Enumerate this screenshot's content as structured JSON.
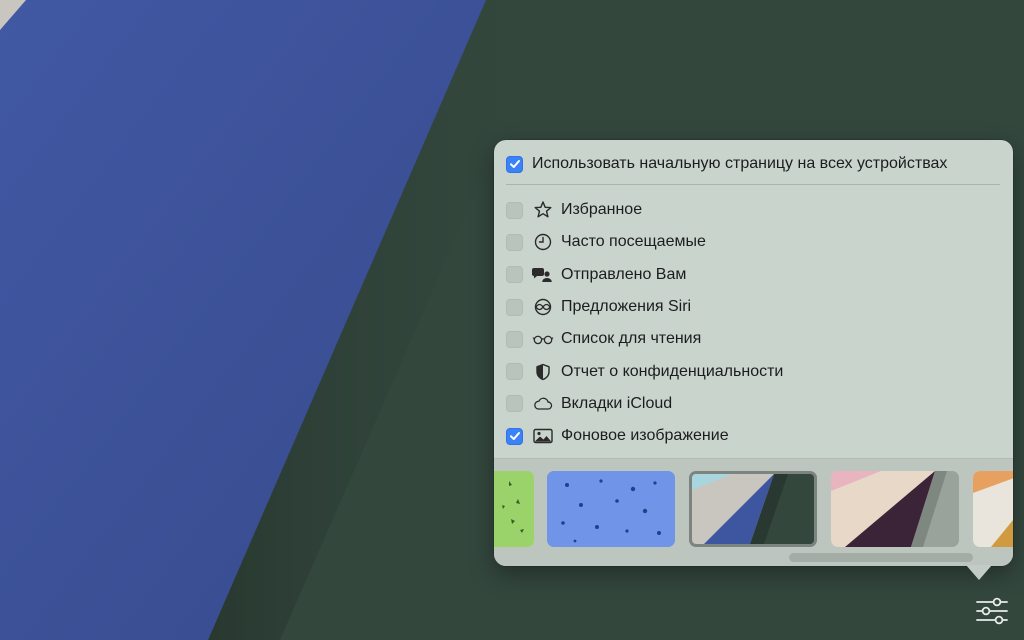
{
  "master": {
    "label": "Использовать начальную страницу на всех устройствах",
    "checked": true
  },
  "items": [
    {
      "label": "Избранное",
      "icon": "star-icon",
      "checked": false
    },
    {
      "label": "Часто посещаемые",
      "icon": "clock-icon",
      "checked": false
    },
    {
      "label": "Отправлено Вам",
      "icon": "shared-with-you-icon",
      "checked": false
    },
    {
      "label": "Предложения Siri",
      "icon": "siri-icon",
      "checked": false
    },
    {
      "label": "Список для чтения",
      "icon": "glasses-icon",
      "checked": false
    },
    {
      "label": "Отчет о конфиденциальности",
      "icon": "shield-icon",
      "checked": false
    },
    {
      "label": "Вкладки iCloud",
      "icon": "cloud-icon",
      "checked": false
    },
    {
      "label": "Фоновое изображение",
      "icon": "photo-icon",
      "checked": true
    }
  ],
  "wallpapers": [
    {
      "name": "green-pattern",
      "selected": false
    },
    {
      "name": "blue-pattern",
      "selected": false
    },
    {
      "name": "blue-green-fold",
      "selected": true
    },
    {
      "name": "pink-purple-fold",
      "selected": false
    },
    {
      "name": "orange-fold",
      "selected": false
    }
  ],
  "colors": {
    "desktop_green": "#33473d",
    "desktop_blue": "#3e55a0",
    "popover_bg": "#c8d4cc",
    "checkbox_accent": "#3b82f6"
  },
  "settings_button": {
    "icon": "sliders-icon"
  }
}
